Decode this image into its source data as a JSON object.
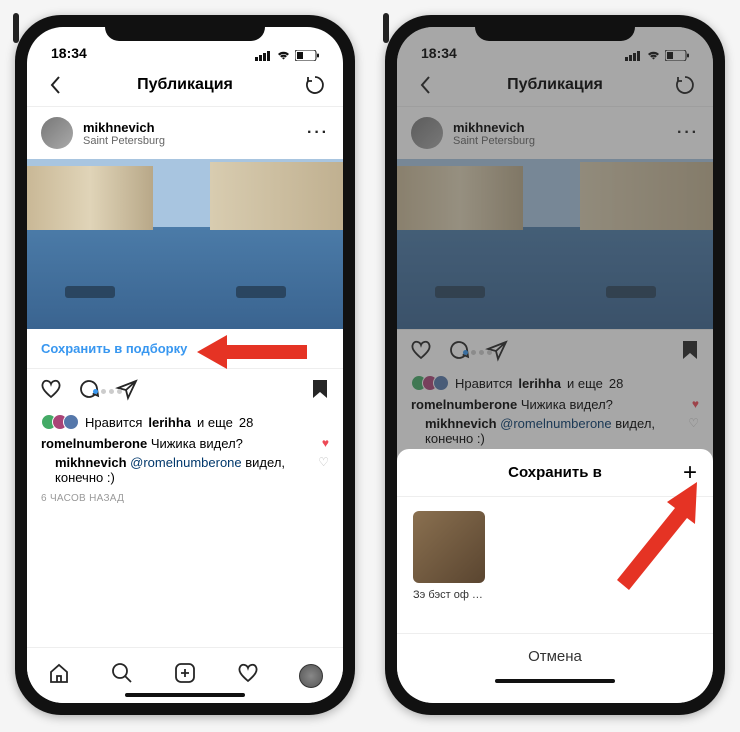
{
  "status": {
    "time": "18:34"
  },
  "nav": {
    "title": "Публикация"
  },
  "post": {
    "username": "mikhnevich",
    "location": "Saint Petersburg",
    "save_to_collection": "Сохранить в подборку",
    "likes_prefix": "Нравится",
    "likes_user": "lerihha",
    "likes_and": "и еще",
    "likes_count": "28",
    "comment1_user": "romelnumberone",
    "comment1_text": "Чижика видел?",
    "reply_user": "mikhnevich",
    "reply_mention": "@romelnumberone",
    "reply_text": "видел, конечно :)",
    "timestamp": "6 ЧАСОВ НАЗАД"
  },
  "sheet": {
    "title": "Сохранить в",
    "collection_name": "Зэ бэст оф з...",
    "cancel": "Отмена"
  }
}
